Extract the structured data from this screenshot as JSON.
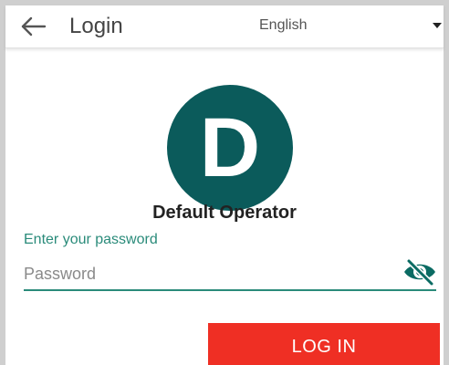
{
  "appbar": {
    "title": "Login",
    "back_icon": "arrow-left-icon",
    "language": {
      "selected": "English",
      "caret_icon": "caret-down-icon"
    }
  },
  "user": {
    "avatar_letter": "D",
    "avatar_color": "#0b5b5b",
    "name": "Default Operator"
  },
  "password_field": {
    "label": "Enter your password",
    "placeholder": "Password",
    "value": "",
    "toggle_icon": "eye-off-icon",
    "accent_color": "#2a8b7a"
  },
  "login_button": {
    "label": "LOG IN",
    "color": "#ef2f24"
  }
}
